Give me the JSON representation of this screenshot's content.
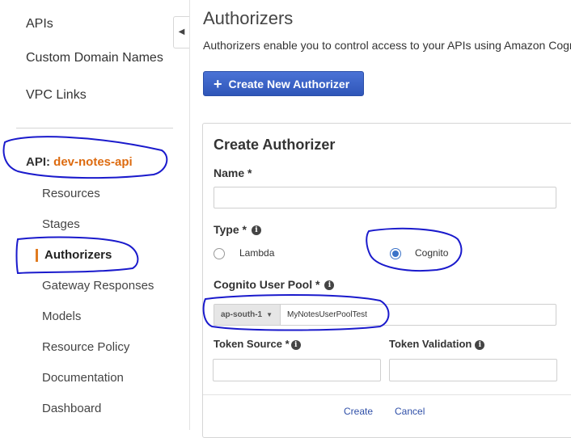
{
  "sidebar": {
    "top_items": [
      {
        "label": "APIs"
      },
      {
        "label": "Custom Domain Names"
      },
      {
        "label": "VPC Links"
      }
    ],
    "api_prefix": "API:",
    "api_name": "dev-notes-api",
    "sub_items": [
      {
        "label": "Resources"
      },
      {
        "label": "Stages"
      },
      {
        "label": "Authorizers",
        "active": true
      },
      {
        "label": "Gateway Responses"
      },
      {
        "label": "Models"
      },
      {
        "label": "Resource Policy"
      },
      {
        "label": "Documentation"
      },
      {
        "label": "Dashboard"
      }
    ],
    "collapse_icon": "triangle-left-icon"
  },
  "main": {
    "title": "Authorizers",
    "description": "Authorizers enable you to control access to your APIs using Amazon Cogni",
    "create_button": "Create New Authorizer",
    "form": {
      "title": "Create Authorizer",
      "name_label": "Name *",
      "name_value": "",
      "type_label": "Type *",
      "type_options": [
        {
          "label": "Lambda",
          "selected": false
        },
        {
          "label": "Cognito",
          "selected": true
        }
      ],
      "user_pool_label": "Cognito User Pool *",
      "region": "ap-south-1",
      "user_pool_value": "MyNotesUserPoolTest",
      "token_source_label": "Token Source *",
      "token_source_value": "",
      "token_validation_label": "Token Validation",
      "token_validation_value": "",
      "create_label": "Create",
      "cancel_label": "Cancel"
    }
  },
  "colors": {
    "accent": "#3b5fc4",
    "api_name": "#dd6b10",
    "active_bar": "#e07b20",
    "annotation_ink": "#1a1acc",
    "link": "#2f4fa8"
  }
}
